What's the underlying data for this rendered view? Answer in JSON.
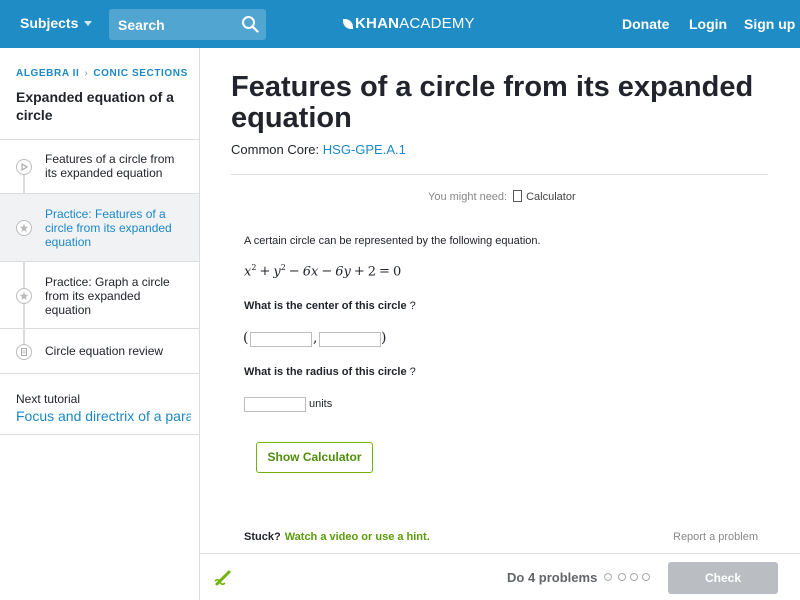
{
  "topbar": {
    "subjects_label": "Subjects",
    "search_placeholder": "Search",
    "logo_text_bold": "KHAN",
    "logo_text": "ACADEMY",
    "donate": "Donate",
    "login": "Login",
    "signup": "Sign up",
    "bg_color": "#1f8cc5"
  },
  "sidebar": {
    "breadcrumb": [
      "ALGEBRA II",
      "CONIC SECTIONS"
    ],
    "title": "Expanded equation of a circle",
    "items": [
      {
        "label": "Features of a circle from its expanded equation",
        "icon": "play-icon",
        "active": false
      },
      {
        "label": "Practice: Features of a circle from its expanded equation",
        "icon": "star-icon",
        "active": true
      },
      {
        "label": "Practice: Graph a circle from its expanded equation",
        "icon": "star-icon",
        "active": false
      },
      {
        "label": "Circle equation review",
        "icon": "article-icon",
        "active": false
      }
    ],
    "next_label": "Next tutorial",
    "next_link": "Focus and directrix of a parabola"
  },
  "main": {
    "title": "Features of a circle from its expanded equation",
    "common_core_label": "Common Core:",
    "common_core_code": "HSG-GPE.A.1",
    "you_might_need": "You might need:",
    "calculator_label": "Calculator",
    "prompt": "A certain circle can be represented by the following equation.",
    "equation": {
      "t1": "x",
      "e1": "2",
      "op1": "+",
      "t2": "y",
      "e2": "2",
      "op2": "−",
      "t3": "6x",
      "op3": "−",
      "t4": "6y",
      "op4": "+",
      "t5": "2",
      "op5": "=",
      "t6": "0"
    },
    "question1": "What is the center of this circle",
    "question2": "What is the radius of this circle",
    "qmark": "?",
    "open_paren": "(",
    "comma": ",",
    "close_paren": ")",
    "units": "units",
    "show_calculator": "Show Calculator",
    "stuck": "Stuck?",
    "hint_link": "Watch a video or use a hint.",
    "report": "Report a problem"
  },
  "footer": {
    "do_problems": "Do 4 problems",
    "check": "Check",
    "progress_dots": 4
  }
}
